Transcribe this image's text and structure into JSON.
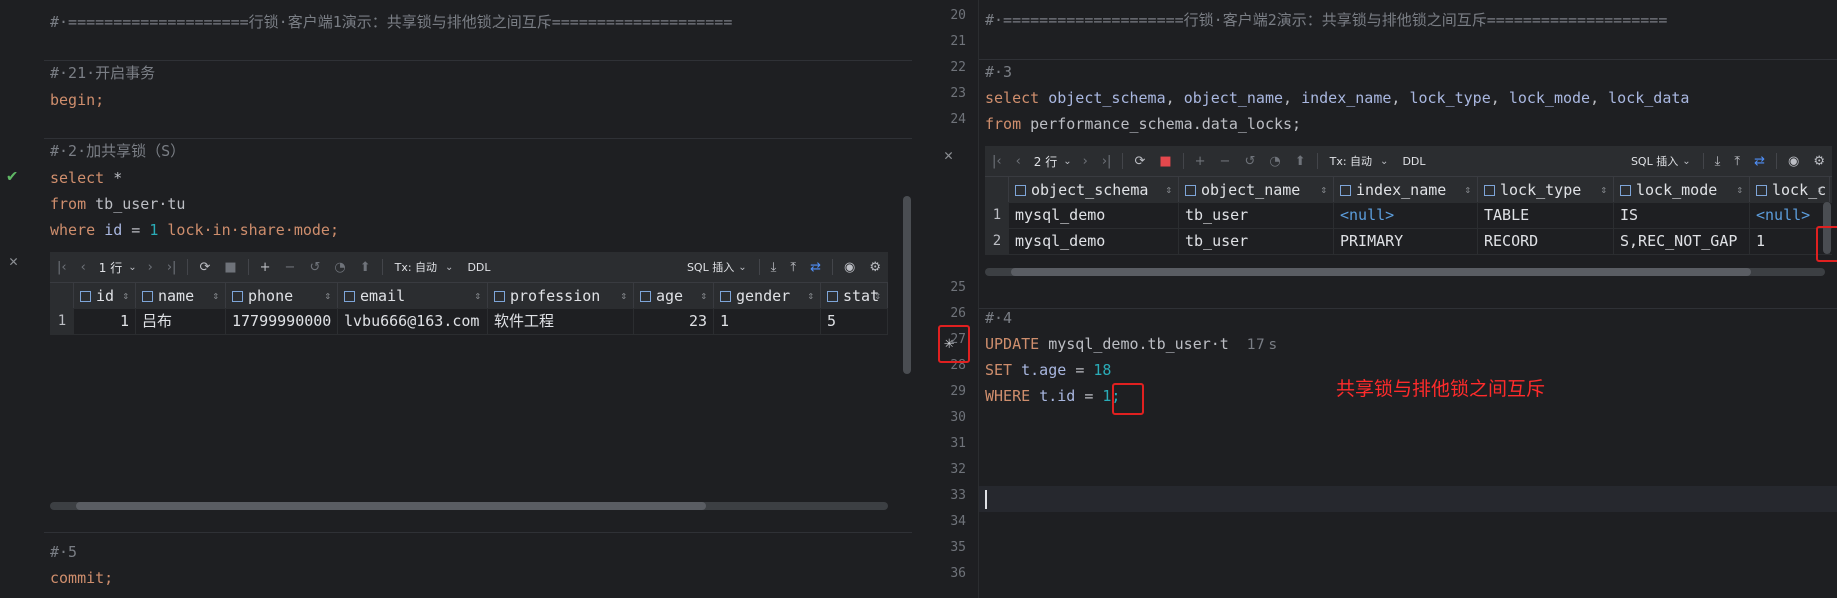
{
  "left": {
    "banner_comment": "#·====================行锁·客户端1演示：共享锁与排他锁之间互斥====================",
    "comment_begin": "#·21·开启事务",
    "begin_stmt": "begin;",
    "comment_share": "#·2·加共享锁（S）",
    "select_kw": "select",
    "select_star": "*",
    "from_kw": "from",
    "from_table": "tb_user·tu",
    "where_kw": "where",
    "where_field": "id",
    "where_op": "=",
    "where_val": "1",
    "lock_clause": "lock·in·share·mode;",
    "comment_commit": "#·5",
    "commit_stmt": "commit;",
    "grid": {
      "rows_label": "1 行",
      "tx_label": "Tx: 自动",
      "ddl_label": "DDL",
      "sql_insert_label": "SQL 插入",
      "columns": [
        "id",
        "name",
        "phone",
        "email",
        "profession",
        "age",
        "gender",
        "stat"
      ],
      "rows": [
        {
          "num": "1",
          "cells": [
            "1",
            "吕布",
            "17799990000",
            "lvbu666@163.com",
            "软件工程",
            "23",
            "1",
            "5"
          ]
        }
      ]
    }
  },
  "right": {
    "line_numbers": [
      "20",
      "21",
      "22",
      "23",
      "24",
      "25",
      "26",
      "27",
      "28",
      "29",
      "30",
      "31",
      "32",
      "33",
      "34",
      "35",
      "36"
    ],
    "banner_comment": "#·====================行锁·客户端2演示：共享锁与排他锁之间互斥====================",
    "comment_3": "#·3",
    "select_kw": "select",
    "select_cols": [
      "object_schema",
      "object_name",
      "index_name",
      "lock_type",
      "lock_mode",
      "lock_data"
    ],
    "from_kw": "from",
    "from_table": "performance_schema.data_locks;",
    "comment_4": "#·4",
    "update_kw": "UPDATE",
    "update_table": "mysql_demo.tb_user·t",
    "elapsed": "17 s",
    "set_kw": "SET",
    "set_field": "t.age",
    "set_op": "=",
    "set_val": "18",
    "where_kw": "WHERE",
    "where_field": "t.id",
    "where_op": "=",
    "where_val": "1;",
    "annotation": "共享锁与排他锁之间互斥",
    "grid": {
      "rows_label": "2 行",
      "tx_label": "Tx: 自动",
      "ddl_label": "DDL",
      "sql_insert_label": "SQL 插入",
      "columns": [
        "object_schema",
        "object_name",
        "index_name",
        "lock_type",
        "lock_mode",
        "lock_c"
      ],
      "rows": [
        {
          "num": "1",
          "cells": [
            "mysql_demo",
            "tb_user",
            "<null>",
            "TABLE",
            "IS",
            "<null>"
          ]
        },
        {
          "num": "2",
          "cells": [
            "mysql_demo",
            "tb_user",
            "PRIMARY",
            "RECORD",
            "S,REC_NOT_GAP",
            "1"
          ]
        }
      ]
    }
  },
  "colors": {
    "accent_red": "#e02020",
    "keyword": "#cf8e6d",
    "number": "#2aacb8",
    "null": "#5c9ddc"
  }
}
